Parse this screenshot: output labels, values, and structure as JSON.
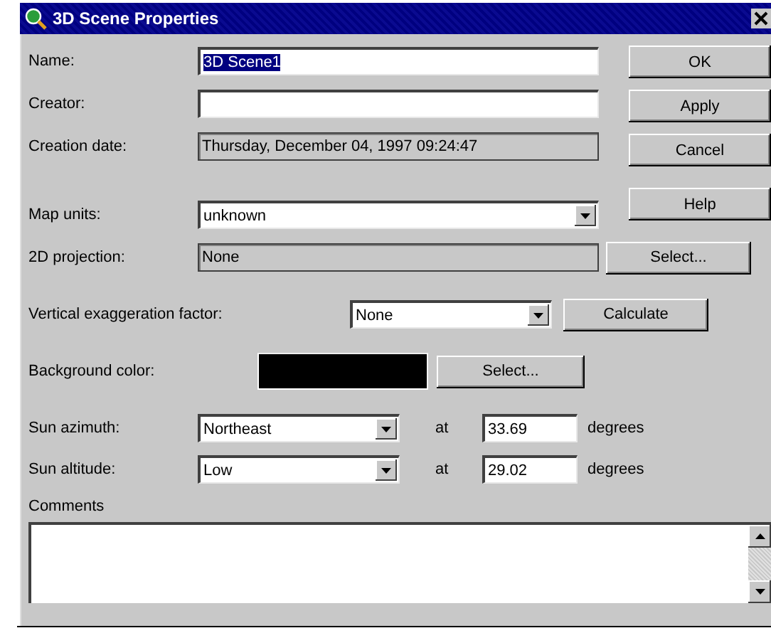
{
  "window": {
    "title": "3D Scene Properties"
  },
  "fields": [
    {
      "label": "Name:",
      "value": "3D Scene1",
      "text_selected": true,
      "read_only": false
    },
    {
      "label": "Creator:",
      "read_only": false
    },
    {
      "label": "Creation date:",
      "value": "Thursday, December 04, 1997 09:24:47",
      "read_only": true
    }
  ],
  "map_units": {
    "label": "Map units:",
    "value": "unknown"
  },
  "buttons": [
    "OK",
    "Apply",
    "Cancel",
    "Help"
  ],
  "projection": {
    "label": "2D projection:",
    "value": "None",
    "read_only": true,
    "button": "Select..."
  },
  "vertical_exaggeration": {
    "label": "Vertical exaggeration factor:",
    "value": "None",
    "button": "Calculate"
  },
  "background": {
    "label": "Background color:",
    "color": "#000000",
    "button": "Select..."
  },
  "sun": [
    {
      "label": "Sun azimuth:",
      "value": "Northeast",
      "at": "at",
      "degrees": "33.69",
      "unit": "degrees"
    },
    {
      "label": "Sun altitude:",
      "value": "Low",
      "at": "at",
      "degrees": "29.02",
      "unit": "degrees"
    }
  ],
  "comments": {
    "label": "Comments"
  }
}
